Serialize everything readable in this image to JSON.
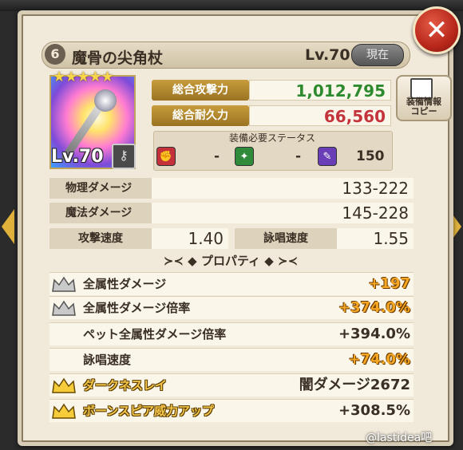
{
  "title_bar": {
    "rarity": "6",
    "name": "魔骨の尖角杖",
    "level": "Lv.70",
    "current_badge": "現在"
  },
  "item": {
    "stars": "★★★★★",
    "level": "Lv.70"
  },
  "stats": {
    "total_attack_label": "総合攻撃力",
    "total_attack_value": "1,012,795",
    "total_durability_label": "総合耐久力",
    "total_durability_value": "66,560",
    "attack_color": "#2e8a2e",
    "durability_color": "#c4343c"
  },
  "copy_button": {
    "label_line1": "装備情報",
    "label_line2": "コピー"
  },
  "requirements": {
    "title": "装備必要ステータス",
    "values": [
      "-",
      "-",
      "150"
    ]
  },
  "damage": {
    "physical_label": "物理ダメージ",
    "physical_value": "133-222",
    "magic_label": "魔法ダメージ",
    "magic_value": "145-228",
    "attack_speed_label": "攻撃速度",
    "attack_speed_value": "1.40",
    "cast_speed_label": "詠唱速度",
    "cast_speed_value": "1.55"
  },
  "properties": {
    "header": "プロパティ",
    "rows": [
      {
        "name": "全属性ダメージ",
        "value": "+197"
      },
      {
        "name": "全属性ダメージ倍率",
        "value": "+374.0%"
      },
      {
        "name": "ペット全属性ダメージ倍率",
        "value": "+394.0%"
      },
      {
        "name": "詠唱速度",
        "value": "+74.0%"
      },
      {
        "name": "ダークネスレイ",
        "value": "闇ダメージ2672"
      },
      {
        "name": "ボーンスピア威力アップ",
        "value": "+308.5%"
      }
    ]
  },
  "watermark": "@lastidea吧"
}
